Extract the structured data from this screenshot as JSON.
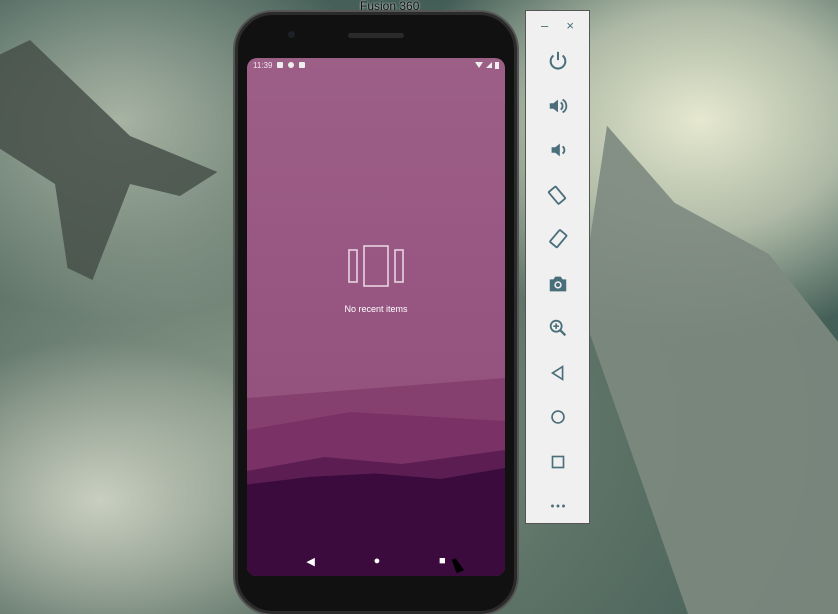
{
  "window": {
    "title": "Fusion 360"
  },
  "status_bar": {
    "time": "11:39"
  },
  "recents": {
    "empty_message": "No recent items"
  },
  "nav": {
    "back": "◀",
    "home": "●",
    "overview": "■"
  },
  "panel": {
    "minimize": "–",
    "close": "×",
    "buttons": [
      {
        "name": "power",
        "label": "Power"
      },
      {
        "name": "volume-up",
        "label": "Volume up"
      },
      {
        "name": "volume-down",
        "label": "Volume down"
      },
      {
        "name": "rotate-left",
        "label": "Rotate left"
      },
      {
        "name": "rotate-right",
        "label": "Rotate right"
      },
      {
        "name": "screenshot",
        "label": "Take screenshot"
      },
      {
        "name": "zoom",
        "label": "Zoom"
      },
      {
        "name": "back",
        "label": "Back"
      },
      {
        "name": "home",
        "label": "Home"
      },
      {
        "name": "overview",
        "label": "Overview"
      },
      {
        "name": "more",
        "label": "More"
      }
    ]
  },
  "colors": {
    "icon": "#4a6f7a",
    "wallpaper_top": "#9c5f86",
    "wallpaper_bottom": "#3a0b3c"
  }
}
